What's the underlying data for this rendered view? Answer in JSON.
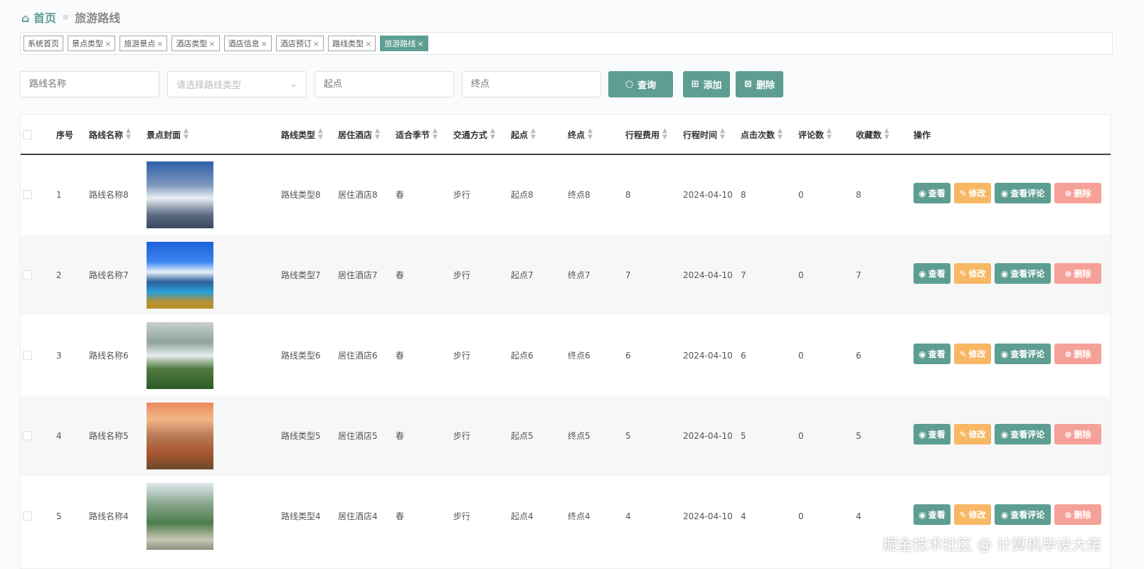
{
  "breadcrumb": {
    "home": "首页",
    "separator": "≡",
    "current": "旅游路线"
  },
  "tags": [
    {
      "label": "系统首页",
      "closable": false
    },
    {
      "label": "景点类型",
      "closable": true
    },
    {
      "label": "旅游景点",
      "closable": true
    },
    {
      "label": "酒店类型",
      "closable": true
    },
    {
      "label": "酒店信息",
      "closable": true
    },
    {
      "label": "酒店预订",
      "closable": true
    },
    {
      "label": "路线类型",
      "closable": true
    },
    {
      "label": "旅游路线",
      "closable": true,
      "active": true
    }
  ],
  "search": {
    "name_placeholder": "路线名称",
    "type_placeholder": "请选择路线类型",
    "start_placeholder": "起点",
    "end_placeholder": "终点",
    "query": "查询",
    "add": "添加",
    "delete": "删除"
  },
  "columns": [
    "序号",
    "路线名称",
    "景点封面",
    "路线类型",
    "居住酒店",
    "适合季节",
    "交通方式",
    "起点",
    "终点",
    "行程费用",
    "行程时间",
    "点击次数",
    "评论数",
    "收藏数",
    "操作"
  ],
  "rows": [
    {
      "index": "1",
      "name": "路线名称8",
      "type": "路线类型8",
      "hotel": "居住酒店8",
      "season": "春",
      "transport": "步行",
      "start": "起点8",
      "end": "终点8",
      "cost": "8",
      "date": "2024-04-10",
      "clicks": "8",
      "comments": "0",
      "favorites": "8"
    },
    {
      "index": "2",
      "name": "路线名称7",
      "type": "路线类型7",
      "hotel": "居住酒店7",
      "season": "春",
      "transport": "步行",
      "start": "起点7",
      "end": "终点7",
      "cost": "7",
      "date": "2024-04-10",
      "clicks": "7",
      "comments": "0",
      "favorites": "7"
    },
    {
      "index": "3",
      "name": "路线名称6",
      "type": "路线类型6",
      "hotel": "居住酒店6",
      "season": "春",
      "transport": "步行",
      "start": "起点6",
      "end": "终点6",
      "cost": "6",
      "date": "2024-04-10",
      "clicks": "6",
      "comments": "0",
      "favorites": "6"
    },
    {
      "index": "4",
      "name": "路线名称5",
      "type": "路线类型5",
      "hotel": "居住酒店5",
      "season": "春",
      "transport": "步行",
      "start": "起点5",
      "end": "终点5",
      "cost": "5",
      "date": "2024-04-10",
      "clicks": "5",
      "comments": "0",
      "favorites": "5"
    },
    {
      "index": "5",
      "name": "路线名称4",
      "type": "路线类型4",
      "hotel": "居住酒店4",
      "season": "春",
      "transport": "步行",
      "start": "起点4",
      "end": "终点4",
      "cost": "4",
      "date": "2024-04-10",
      "clicks": "4",
      "comments": "0",
      "favorites": "4"
    }
  ],
  "actions": {
    "view": "查看",
    "edit": "修改",
    "comments": "查看评论",
    "delete": "删除"
  },
  "colors": {
    "primary": "#5e9e92",
    "edit": "#f7b865",
    "delete": "#f6a197"
  },
  "watermark": "掘金技术社区 @ 计算机毕设大佬"
}
